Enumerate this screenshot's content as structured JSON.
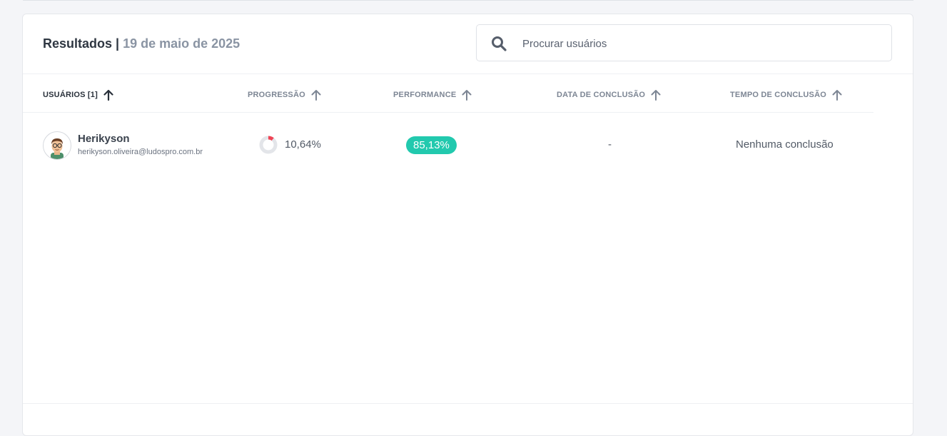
{
  "header": {
    "title": "Resultados |",
    "date": "19 de maio de 2025"
  },
  "search": {
    "placeholder": "Procurar usuários",
    "value": ""
  },
  "table": {
    "columns": [
      {
        "label": "USUÁRIOS [1]",
        "sort": "asc",
        "active": true
      },
      {
        "label": "PROGRESSÃO",
        "sort": "asc",
        "active": false
      },
      {
        "label": "PERFORMANCE",
        "sort": "asc",
        "active": false
      },
      {
        "label": "DATA DE CONCLUSÃO",
        "sort": "asc",
        "active": false
      },
      {
        "label": "TEMPO DE CONCLUSÃO",
        "sort": "asc",
        "active": false
      }
    ],
    "rows": [
      {
        "name": "Herikyson",
        "email": "herikyson.oliveira@ludospro.com.br",
        "progress_value": 10.64,
        "progress": "10,64%",
        "performance": "85,13%",
        "completion_date": "-",
        "completion_time": "Nenhuma conclusão"
      }
    ]
  },
  "colors": {
    "performance_badge": "#22c9ae",
    "progress_fill": "#ef4455",
    "progress_track": "#e3e5e9"
  },
  "icons": {
    "search": "search-icon",
    "sort": "arrow-up-icon",
    "avatar": "cartoon-avatar"
  }
}
